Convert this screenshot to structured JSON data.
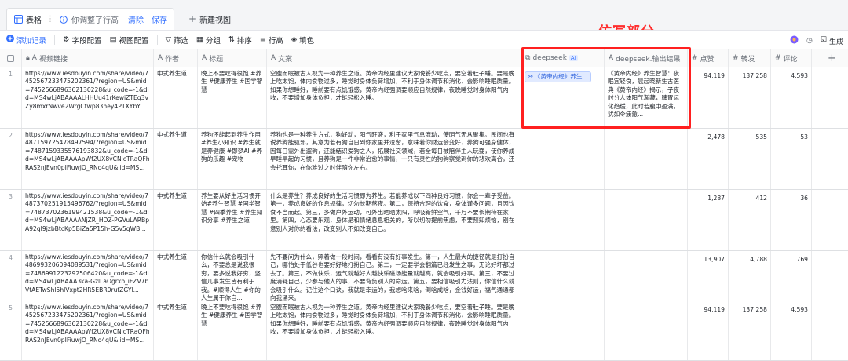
{
  "topbar": {
    "table_label": "表格",
    "more": "⋮",
    "unsaved_notice": "你调整了行高",
    "clear": "清除",
    "save": "保存",
    "new_view": "新建视图"
  },
  "toolbar": {
    "add_record": "添加记录",
    "field_config": "字段配置",
    "view_config": "视图配置",
    "filter": "筛选",
    "group": "分组",
    "sort": "排序",
    "row_height": "行高",
    "fill_color": "填色",
    "generate": "生成"
  },
  "annotation": "仿写部分",
  "columns": [
    {
      "label": "视频链接",
      "icon": "A"
    },
    {
      "label": "作者",
      "icon": "A"
    },
    {
      "label": "标题",
      "icon": "A"
    },
    {
      "label": "文案",
      "icon": "A"
    },
    {
      "label": "deepseek",
      "icon": "link",
      "badge": "AI"
    },
    {
      "label": "deepseek.输出结果",
      "icon": "A"
    },
    {
      "label": "点赞",
      "icon": "#"
    },
    {
      "label": "转发",
      "icon": "#"
    },
    {
      "label": "评论",
      "icon": "#"
    }
  ],
  "rows": [
    {
      "num": "1",
      "link": "https://www.iesdouyin.com/share/video/7452567233475202361/?region=US&mid=7452566896362130228&u_code=-1&did=MS4wLjABAAAALHHUu41rKewiZTEq3vZy8mxrNwve2WrgCtwp83hey4P1XYbY...",
      "author": "中式养生道",
      "title": "晚上不要吃得很饱 #养生 #健康养生 #国学智慧",
      "copy": "空腹而眠被古人视为一种养生之道。黄帝内经里建议大家晚餐少吃点，要空着肚子睡。要是晚上吃太饱，体内食物过多，睡觉时身体负荷增加，不利于身体调节和消化，会影响睡眠质量。如果你想睡好，睡前要有点饥饿感，黄帝内经强调要顺应自然规律，夜晚睡觉时身体阳气内收，不要增加身体负担，才能轻松入睡。",
      "deepseek": "《黄帝内经》养生...",
      "output": "《黄帝内经》养生智慧：夜眠宜轻食，晨起晓新生古医典《黄帝内经》揭示，子夜时分人体阳气渐藏，脾胃运化趋缓，此时若腹中盈满，犹如令疲惫...",
      "likes": "94,119",
      "shares": "137,258",
      "comments": "4,593"
    },
    {
      "num": "2",
      "link": "https://www.iesdouyin.com/share/video/7487159725478497594/?region=US&mid=7487159335576193832&u_code=-1&did=MS4wLjABAAAApWf2UX8vCNlcTRaQFhRAS2nJEvn0pIFiuwjO_RNo4qU&iid=MS...",
      "author": "中式养生道",
      "title": "养狗还能起到养生作用 #养生小知识 #养生就是养健康 #即梦AI #养狗的乐趣 #宠物",
      "copy": "养狗也是一种养生方式，狗好动，阳气旺盛，利于家里气息流动，使阴气无从聚集。民间也有说养狗能驱邪，其意为若有狗自日到你家里并逗留，意味着你财运会变好，养狗可强身健体，因每日需外出遛狗，还能结识爱狗之人，拓展社交领域，若全每日被陪伴主人玩耍，使你养成早睡早起的习惯，且养狗是一件非常治愈的事情，一只有灵性的狗狗察觉到你的悲欢离合，还会托耳你，在你难过之时伴随你左右。",
      "deepseek": "",
      "output": "",
      "likes": "2,478",
      "shares": "535",
      "comments": "53"
    },
    {
      "num": "3",
      "link": "https://www.iesdouyin.com/share/video/7487370251915496762/?region=US&mid=7487370236199421538&u_code=-1&did=MS4wLjABAAAANjZR_HDZ-PGVuLARBpA92qI9jzbBtcKp5BiZa5P15h-G5v5qWB...",
      "author": "中式养生道",
      "title": "养生要从好生活习惯开始#养生智慧 #国学智慧 #四季养生 #养生知识分享 #养生之道",
      "copy": "什么是养生？养成良好的生活习惯即为养生。若能养成以下四种良好习惯，你会一辈子受益。第一，养成良好的作息规律，切勿长期熬夜。第二，保持合理的饮食，身体谨多问题，且因饮食不当而起。第三，多做户外运动，可外出晒晒太阳，呼吸新鲜空气，千万不要长期待在家里。第四，心态要乐观，身体是和情绪息息相关的，所以切勿提前焦虑，不要预知烦恼，别在意别人对你的看法，改变别人不如改变自己。",
      "deepseek": "",
      "output": "",
      "likes": "1,287",
      "shares": "412",
      "comments": "36"
    },
    {
      "num": "4",
      "link": "https://www.iesdouyin.com/share/video/7486993206094089531/?region=US&mid=7486991223292506420&u_code=-1&did=MS4wLjABAAA3ka-GzlLaOgrxb_iFZV7bVtAETwShl5hlVxpt2HR5EBR0rufZGYl...",
      "author": "中式养生道",
      "title": "你信什么就会吸引什么，不要总是说我很穷，要多说我好穷，坚信几事发生皆有利于我。#顺得人生 #你的人生属于你自...",
      "copy": "先不要问为什么，照着做一段时间，看看有没有好事发生。第一，人生最大的捷径就是打扮自己，哪怕处于低谷也要好好地打扮自己。第二，一定要学会翻篇已经发生之事，无论好坏都过去了。第三，不做快乐，运气就越好人越快乐磁场能量就越高，就会吸引好事。第三，不要过度消耗自己，少参与他人的事，不要背负别人的命运。第五，要相信吸引力法则，你信什么就会吸引什么。记住这个口诀，我就是幸运的，我想啥来啥，倒啥成啥，金钱好运，福气通通都向我涌来。",
      "deepseek": "",
      "output": "",
      "likes": "13,907",
      "shares": "4,788",
      "comments": "769"
    },
    {
      "num": "5",
      "link": "https://www.iesdouyin.com/share/video/7452567233475202361/?region=US&mid=7452566896362130228&u_code=-1&did=MS4wLjABAAAApWf2UX8vCNlcTRaQFhRAS2nJEvn0pIFiuwjO_RNo4qU&iid=MS...",
      "author": "中式养生道",
      "title": "晚上不要吃得很饱 #养生 #健康养生 #国学智慧",
      "copy": "空腹而眠被古人视为一种养生之道。黄帝内经里建议大家晚餐少吃点，要空着肚子睡。要是晚上吃太饱，体内食物过多，睡觉时身体负荷增加，不利于身体调节和消化，会影响睡眠质量。如果你想睡好，睡前要有点饥饿感，黄帝内经强调要顺应自然规律，夜晚睡觉时身体阳气内收，不要增加身体负担，才能轻松入睡。",
      "deepseek": "",
      "output": "",
      "likes": "94,119",
      "shares": "137,258",
      "comments": "4,593"
    }
  ],
  "colors": {
    "accent": "#3370ff",
    "annotation": "#ff2020"
  }
}
